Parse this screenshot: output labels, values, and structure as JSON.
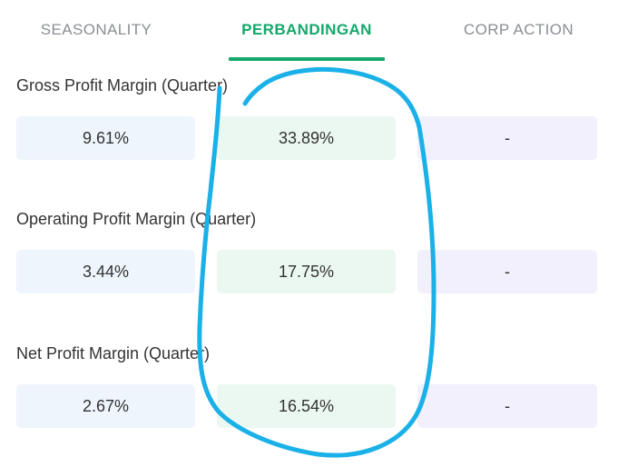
{
  "tabs": [
    {
      "label": "SEASONALITY",
      "active": false
    },
    {
      "label": "PERBANDINGAN",
      "active": true
    },
    {
      "label": "CORP ACTION",
      "active": false
    }
  ],
  "metrics": [
    {
      "title": "Gross Profit Margin (Quarter)",
      "values": [
        "9.61%",
        "33.89%",
        "-"
      ]
    },
    {
      "title": "Operating Profit Margin (Quarter)",
      "values": [
        "3.44%",
        "17.75%",
        "-"
      ]
    },
    {
      "title": "Net Profit Margin (Quarter)",
      "values": [
        "2.67%",
        "16.54%",
        "-"
      ]
    }
  ],
  "colors": {
    "accent": "#14a86b",
    "inactive_tab": "#8a8f94",
    "box_blue": "#eef5fc",
    "box_green": "#ebf8f1",
    "box_purple": "#f1f0fc",
    "annotation": "#1ab0e8"
  }
}
